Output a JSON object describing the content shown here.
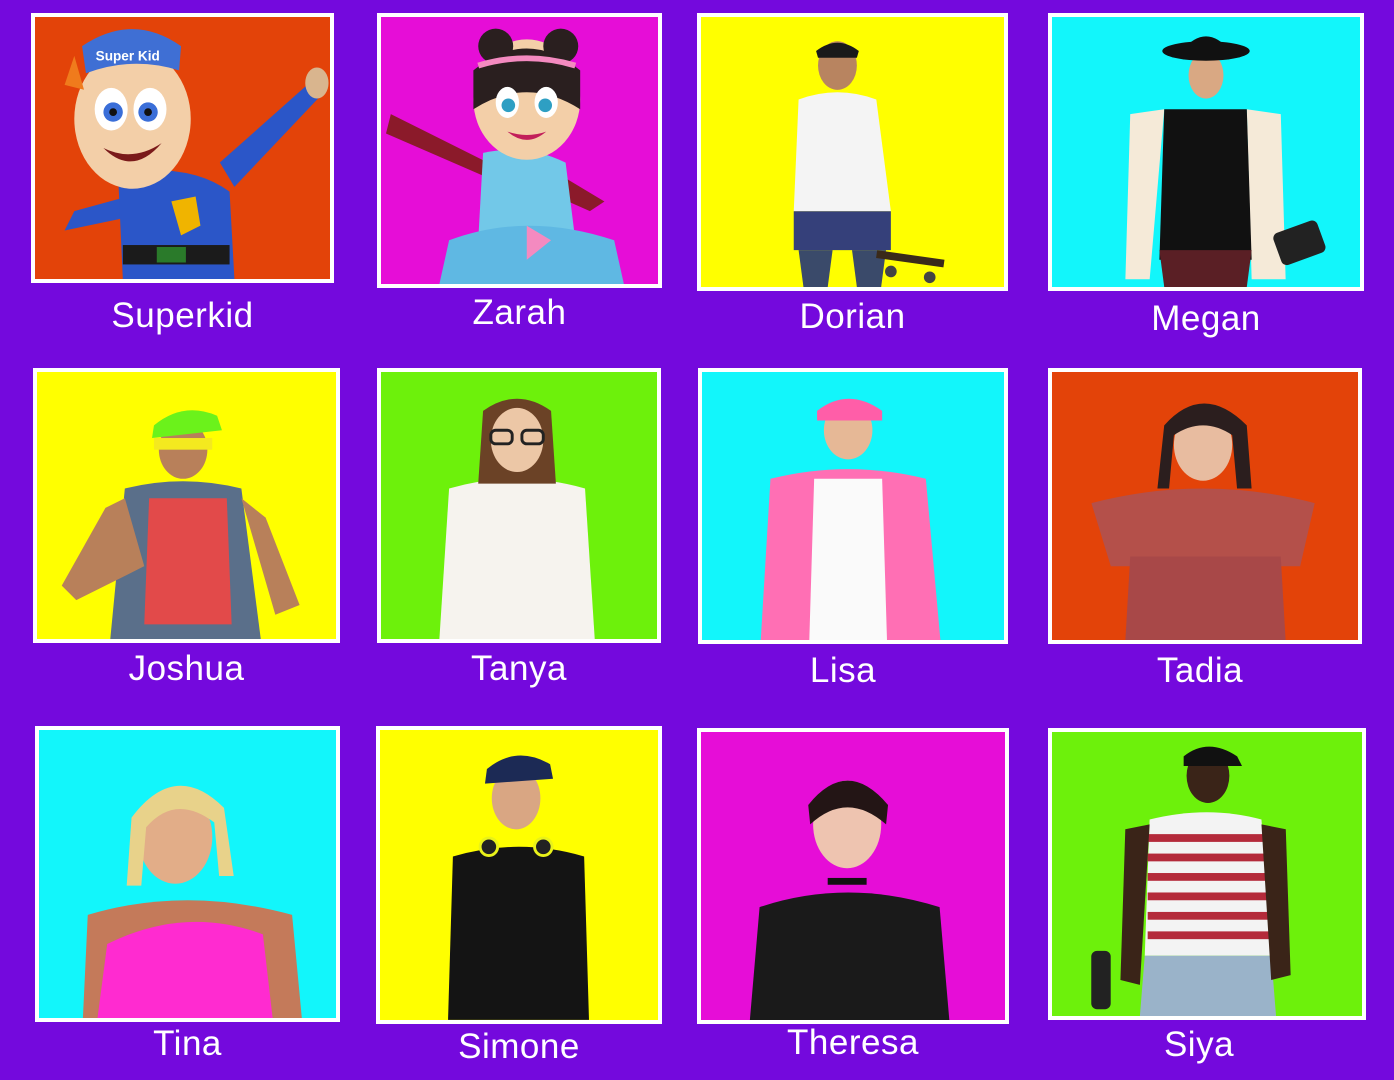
{
  "cast": [
    {
      "name": "Superkid",
      "bg": "#e34309",
      "icon": "mascot-boy-icon",
      "cap": "Super Kid"
    },
    {
      "name": "Zarah",
      "bg": "#e60dd7",
      "icon": "mascot-girl-icon"
    },
    {
      "name": "Dorian",
      "bg": "#ffff00",
      "icon": "person-skateboard-icon"
    },
    {
      "name": "Megan",
      "bg": "#12f6fb",
      "icon": "person-hat-icon"
    },
    {
      "name": "Joshua",
      "bg": "#ffff00",
      "icon": "person-cap-glasses-icon"
    },
    {
      "name": "Tanya",
      "bg": "#6df10b",
      "icon": "person-glasses-icon"
    },
    {
      "name": "Lisa",
      "bg": "#12f6fb",
      "icon": "person-pink-jacket-icon"
    },
    {
      "name": "Tadia",
      "bg": "#e34309",
      "icon": "person-offshoulder-icon"
    },
    {
      "name": "Tina",
      "bg": "#12f6fb",
      "icon": "person-blonde-icon"
    },
    {
      "name": "Simone",
      "bg": "#ffff00",
      "icon": "person-headphones-icon"
    },
    {
      "name": "Theresa",
      "bg": "#e60dd7",
      "icon": "person-choker-icon"
    },
    {
      "name": "Siya",
      "bg": "#6df10b",
      "icon": "person-striped-shirt-icon"
    }
  ]
}
